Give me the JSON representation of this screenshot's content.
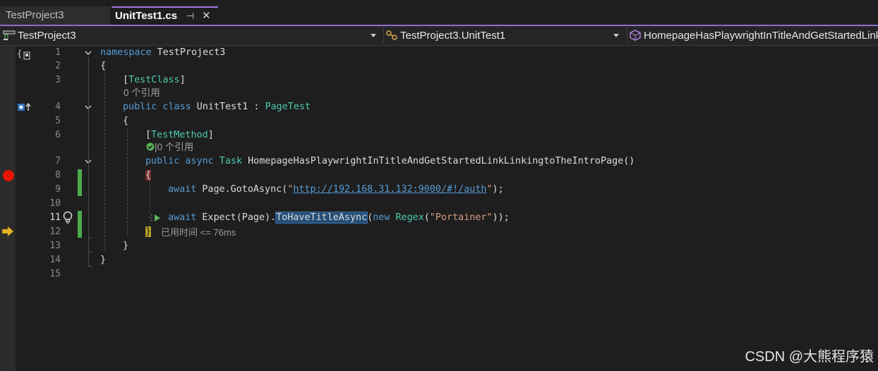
{
  "tabs": [
    {
      "label": "TestProject3",
      "active": false
    },
    {
      "label": "UnitTest1.cs",
      "active": true,
      "pin_icon": "pin-icon",
      "close_icon": "close-icon"
    }
  ],
  "navbar": {
    "project": "TestProject3",
    "class": "TestProject3.UnitTest1",
    "member": "HomepageHasPlaywrightInTitleAndGetStartedLinkLinkingtoTheIntroPage()"
  },
  "line_numbers": [
    "1",
    "2",
    "3",
    "4",
    "5",
    "6",
    "7",
    "8",
    "9",
    "10",
    "11",
    "12",
    "13",
    "14",
    "15"
  ],
  "code": {
    "l1_kw": "namespace",
    "l1_name": " TestProject3",
    "l2": "{",
    "l3_open": "[",
    "l3_attr": "TestClass",
    "l3_close": "]",
    "l3_refs": "0 个引用",
    "l4_kw1": "public",
    "l4_kw2": " class",
    "l4_name": " UnitTest1 : ",
    "l4_base": "PageTest",
    "l5": "{",
    "l6_open": "[",
    "l6_attr": "TestMethod",
    "l6_close": "]",
    "l6_refs": "|0 个引用",
    "l7_kw1": "public",
    "l7_kw2": " async",
    "l7_type": " Task",
    "l7_name": " HomepageHasPlaywrightInTitleAndGetStartedLinkLinkingtoTheIntroPage()",
    "l8": "{",
    "l9_kw": "await",
    "l9_a": " Page.GotoAsync(",
    "l9_q1": "\"",
    "l9_url": "http://192.168.31.132:9000/#!/auth",
    "l9_q2": "\"",
    "l9_b": ");",
    "l11_kw": "await",
    "l11_a": " Expect(Page).",
    "l11_sel": "ToHaveTitleAsync",
    "l11_b": "(",
    "l11_new": "new",
    "l11_type": " Regex",
    "l11_c": "(",
    "l11_str": "\"Portainer\"",
    "l11_d": "));",
    "l12": "}",
    "l12_elapsed": "已用时间 <= 76ms",
    "l13": "}",
    "l14": "}"
  },
  "watermark": "CSDN @大熊程序猿",
  "colors": {
    "keyword": "#569cd6",
    "type": "#4ec9b0",
    "string": "#d69d85",
    "breakpoint": "#e51400",
    "change_bar": "#4caa4c",
    "accent": "#8e6fcf"
  },
  "icons": [
    "pin-icon",
    "close-icon",
    "project-icon",
    "class-icon",
    "method-cube-icon",
    "breakpoint-icon",
    "execution-arrow-icon",
    "lightbulb-icon",
    "test-pass-icon",
    "test-run-icon"
  ]
}
